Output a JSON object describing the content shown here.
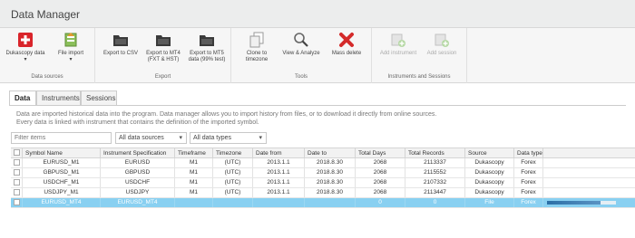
{
  "window": {
    "title": "Data Manager"
  },
  "ribbon": {
    "groups": [
      {
        "label": "Data sources",
        "buttons": [
          {
            "label": "Dukascopy data",
            "icon": "red-cross-icon",
            "has_menu": true
          },
          {
            "label": "File import",
            "icon": "file-import-icon",
            "has_menu": true
          }
        ]
      },
      {
        "label": "Export",
        "buttons": [
          {
            "label": "Export to CSV",
            "icon": "folder-export-icon"
          },
          {
            "label": "Export to MT4 (FXT & HST)",
            "icon": "folder-export-icon"
          },
          {
            "label": "Export to MT5 data (99% test)",
            "icon": "folder-export-icon"
          }
        ]
      },
      {
        "label": "Tools",
        "buttons": [
          {
            "label": "Clone to timezone",
            "icon": "clone-icon"
          },
          {
            "label": "View & Analyze",
            "icon": "magnifier-icon"
          },
          {
            "label": "Mass delete",
            "icon": "red-x-icon"
          }
        ]
      },
      {
        "label": "Instruments and Sessions",
        "buttons": [
          {
            "label": "Add instrument",
            "icon": "add-instrument-icon",
            "disabled": true
          },
          {
            "label": "Add session",
            "icon": "add-session-icon",
            "disabled": true
          }
        ]
      }
    ]
  },
  "tabs": [
    {
      "label": "Data",
      "active": true
    },
    {
      "label": "Instruments",
      "active": false
    },
    {
      "label": "Sessions",
      "active": false
    }
  ],
  "description": {
    "line1": "Data are imported historical data into the program. Data manager allows you to import history from files, or to download it directly from online sources.",
    "line2": "Every data is linked with instrument that contains the definition of the imported symbol."
  },
  "filters": {
    "search_placeholder": "Filter items",
    "source_value": "All data sources",
    "type_value": "All data types"
  },
  "table": {
    "columns": [
      "Symbol Name",
      "Instrument Specification",
      "Timeframe",
      "Timezone",
      "Date from",
      "Date to",
      "Total Days",
      "Total Records",
      "Source",
      "Data type"
    ],
    "rows": [
      {
        "symbol": "EURUSD_M1",
        "spec": "EURUSD",
        "timeframe": "M1",
        "timezone": "(UTC)",
        "date_from": "2013.1.1",
        "date_to": "2018.8.30",
        "days": "2068",
        "records": "2113337",
        "source": "Dukascopy",
        "type": "Forex",
        "selected": false
      },
      {
        "symbol": "GBPUSD_M1",
        "spec": "GBPUSD",
        "timeframe": "M1",
        "timezone": "(UTC)",
        "date_from": "2013.1.1",
        "date_to": "2018.8.30",
        "days": "2068",
        "records": "2115552",
        "source": "Dukascopy",
        "type": "Forex",
        "selected": false
      },
      {
        "symbol": "USDCHF_M1",
        "spec": "USDCHF",
        "timeframe": "M1",
        "timezone": "(UTC)",
        "date_from": "2013.1.1",
        "date_to": "2018.8.30",
        "days": "2068",
        "records": "2107332",
        "source": "Dukascopy",
        "type": "Forex",
        "selected": false
      },
      {
        "symbol": "USDJPY_M1",
        "spec": "USDJPY",
        "timeframe": "M1",
        "timezone": "(UTC)",
        "date_from": "2013.1.1",
        "date_to": "2018.8.30",
        "days": "2068",
        "records": "2113447",
        "source": "Dukascopy",
        "type": "Forex",
        "selected": false
      },
      {
        "symbol": "EURUSD_MT4",
        "spec": "EURUSD_MT4",
        "timeframe": "",
        "timezone": "",
        "date_from": "",
        "date_to": "",
        "days": "0",
        "records": "0",
        "source": "File",
        "type": "Forex",
        "selected": true,
        "progress": 0.78
      }
    ]
  },
  "colors": {
    "selection": "#89d0f1",
    "progress": "#2b6fa6"
  }
}
